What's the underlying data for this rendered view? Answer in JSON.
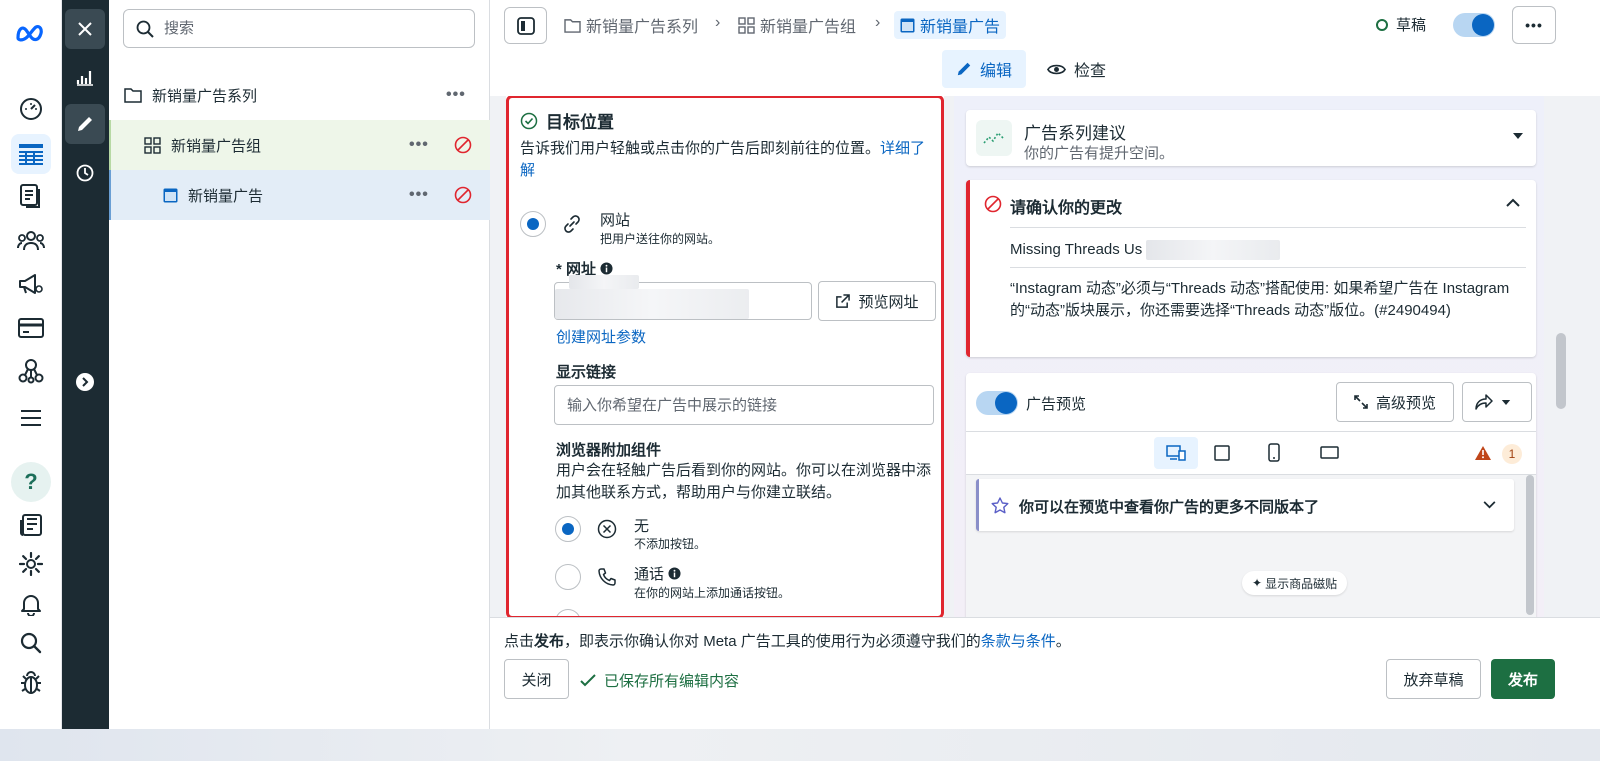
{
  "tree": {
    "search_placeholder": "搜索",
    "campaign": "新销量广告系列",
    "adset": "新销量广告组",
    "ad": "新销量广告",
    "more": "•••"
  },
  "topbar": {
    "crumb_campaign": "新销量广告系列",
    "crumb_adset": "新销量广告组",
    "crumb_ad": "新销量广告",
    "status": "草稿",
    "more": "•••",
    "tab_edit": "编辑",
    "tab_review": "检查"
  },
  "destination": {
    "title": "目标位置",
    "desc": "告诉我们用户轻触或点击你的广告后即刻前往的位置。",
    "learn_more": "详细了解",
    "website_title": "网站",
    "website_sub": "把用户送往你的网站。",
    "url_label": "* 网址",
    "preview_url": "预览网址",
    "create_params": "创建网址参数",
    "display_link_label": "显示链接",
    "display_link_placeholder": "输入你希望在广告中展示的链接",
    "browser_addon_label": "浏览器附加组件",
    "browser_addon_desc": "用户会在轻触广告后看到你的网站。你可以在浏览器中添加其他联系方式，帮助用户与你建立联结。",
    "none_title": "无",
    "none_sub": "不添加按钮。",
    "call_title": "通话",
    "call_sub": "在你的网站上添加通话按钮。"
  },
  "recommendations": {
    "title": "广告系列建议",
    "sub": "你的广告有提升空间。"
  },
  "confirm": {
    "title": "请确认你的更改",
    "missing": "Missing Threads Us",
    "message": "“Instagram 动态”必须与“Threads 动态”搭配使用: 如果希望广告在 Instagram 的“动态”版块展示，你还需要选择“Threads 动态”版位。(#2490494)"
  },
  "preview": {
    "label": "广告预览",
    "advanced": "高级预览",
    "warn_count": "1",
    "banner": "你可以在预览中查看你广告的更多不同版本了",
    "show_product_tags": "显示商品磁贴"
  },
  "footer": {
    "note_prefix": "点击",
    "note_bold": "发布",
    "note_mid": "，即表示你确认你对 Meta 广告工具的使用行为必须遵守我们的",
    "note_link": "条款与条件",
    "note_suffix": "。",
    "close": "关闭",
    "saved": "已保存所有编辑内容",
    "discard": "放弃草稿",
    "publish": "发布"
  },
  "colors": {
    "accent": "#0a66c2",
    "publish_green": "#1d6f42",
    "error_red": "#e0262f"
  }
}
